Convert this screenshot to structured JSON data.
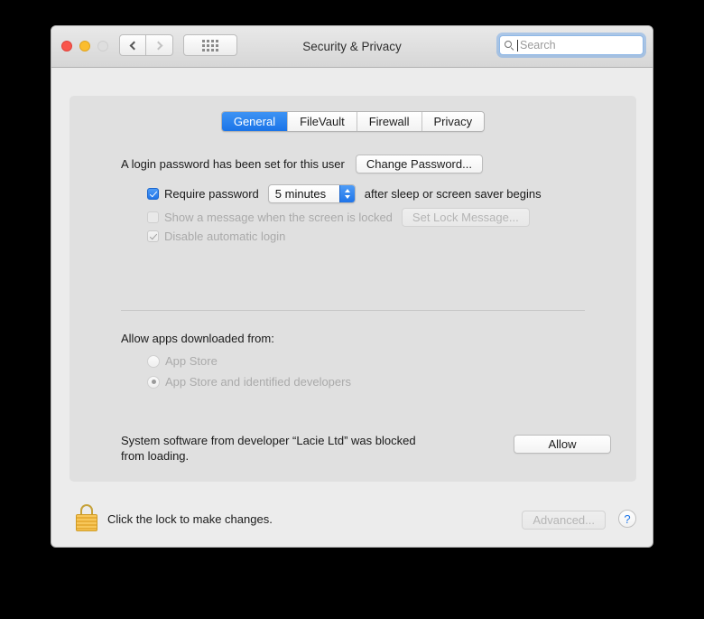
{
  "window": {
    "title": "Security & Privacy",
    "traffic_lights": [
      "close-button",
      "minimize-button",
      "zoom-button"
    ],
    "nav": {
      "back": "back-icon",
      "forward": "forward-icon",
      "grid": "show-all-icon"
    }
  },
  "search": {
    "placeholder": "Search",
    "value": "",
    "icon": "search-icon"
  },
  "tabs": [
    {
      "label": "General",
      "active": true
    },
    {
      "label": "FileVault",
      "active": false
    },
    {
      "label": "Firewall",
      "active": false
    },
    {
      "label": "Privacy",
      "active": false
    }
  ],
  "general": {
    "password_status": "A login password has been set for this user",
    "change_password_button": "Change Password...",
    "require_password": {
      "label": "Require password",
      "checked": true,
      "enabled": true,
      "delay_value": "5 minutes",
      "suffix": "after sleep or screen saver begins"
    },
    "show_message": {
      "label": "Show a message when the screen is locked",
      "checked": false,
      "enabled": false,
      "button": "Set Lock Message..."
    },
    "disable_auto_login": {
      "label": "Disable automatic login",
      "checked": true,
      "enabled": false
    }
  },
  "gatekeeper": {
    "heading": "Allow apps downloaded from:",
    "options": [
      {
        "label": "App Store",
        "selected": false,
        "enabled": false
      },
      {
        "label": "App Store and identified developers",
        "selected": true,
        "enabled": false
      }
    ]
  },
  "blocked_software": {
    "line1": "System software from developer “Lacie Ltd” was blocked",
    "line2": "from loading.",
    "allow_button": "Allow"
  },
  "footer": {
    "lock_icon": "lock-closed-icon",
    "lock_text": "Click the lock to make changes.",
    "advanced_button": "Advanced...",
    "advanced_enabled": false,
    "help_button": "?"
  },
  "colors": {
    "accent_blue": "#1a74e8",
    "lock_gold": "#f7c75a",
    "window_bg": "#ececec",
    "panel_bg": "#e0e0e0"
  }
}
